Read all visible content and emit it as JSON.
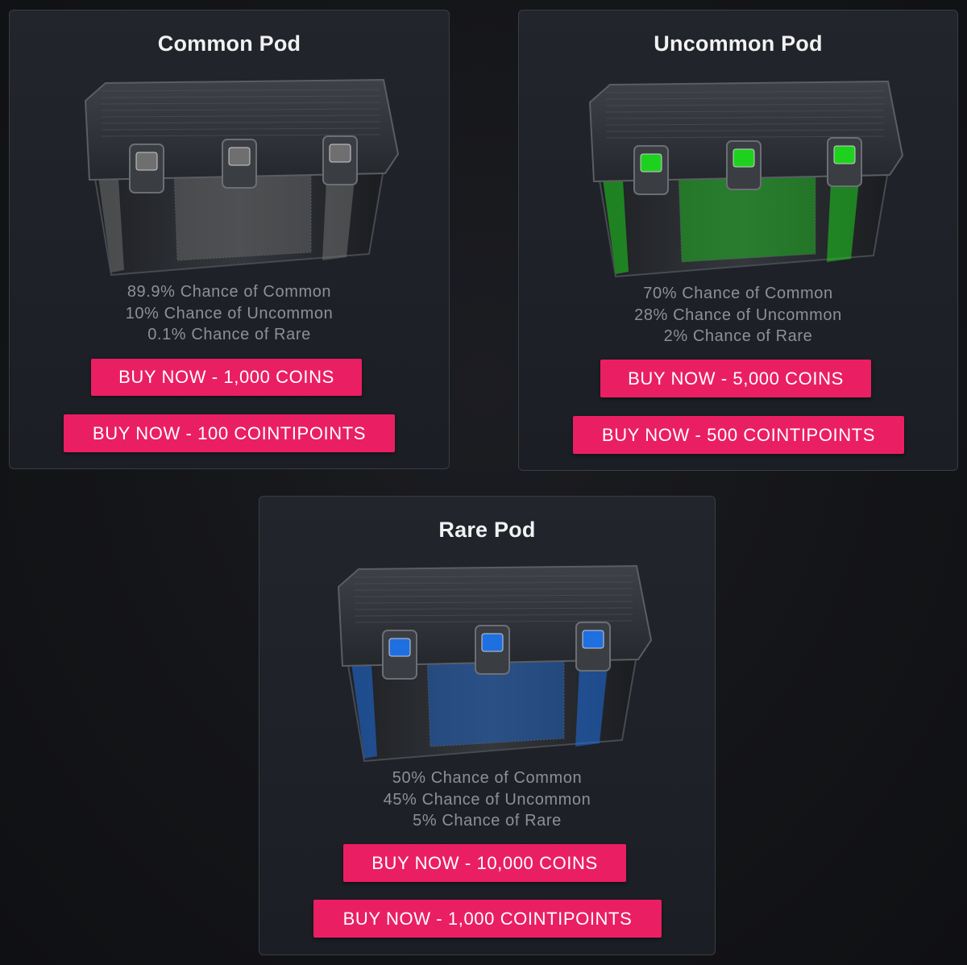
{
  "pods": [
    {
      "title": "Common Pod",
      "accent": "#6f6f6f",
      "odds": [
        "89.9% Chance of Common",
        "10% Chance of Uncommon",
        "0.1% Chance of Rare"
      ],
      "buy_coins": "BUY NOW - 1,000 COINS",
      "buy_points": "BUY NOW - 100 COINTIPOINTS"
    },
    {
      "title": "Uncommon Pod",
      "accent": "#1fd11f",
      "odds": [
        "70% Chance of Common",
        "28% Chance of Uncommon",
        "2% Chance of Rare"
      ],
      "buy_coins": "BUY NOW - 5,000 COINS",
      "buy_points": "BUY NOW - 500 COINTIPOINTS"
    },
    {
      "title": "Rare Pod",
      "accent": "#1f6fe0",
      "odds": [
        "50% Chance of Common",
        "45% Chance of Uncommon",
        "5% Chance of Rare"
      ],
      "buy_coins": "BUY NOW - 10,000 COINS",
      "buy_points": "BUY NOW - 1,000 COINTIPOINTS"
    }
  ],
  "colors": {
    "button": "#ea1f63",
    "card_bg": "#1f2228",
    "odds_text": "#8d9095"
  }
}
